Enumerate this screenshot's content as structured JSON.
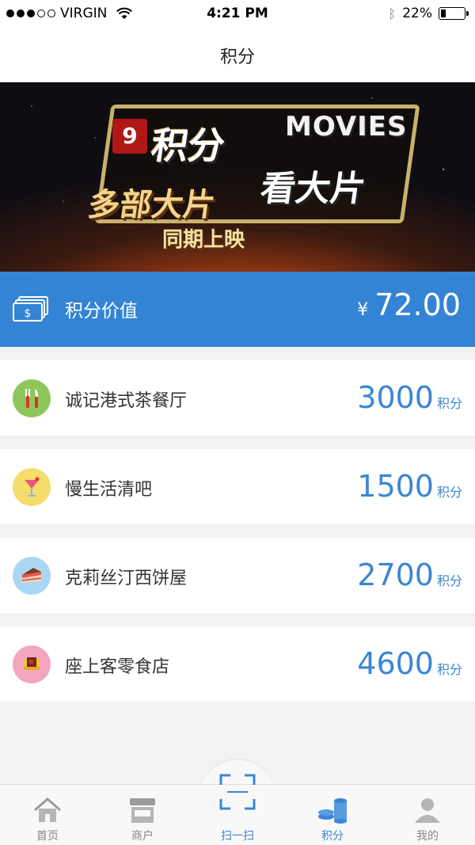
{
  "status_bar": {
    "carrier": "VIRGIN",
    "time": "4:21 PM",
    "battery": "22%",
    "battery_level": 0.22
  },
  "nav": {
    "title": "积分"
  },
  "banner": {
    "badge": "9",
    "line1": "积分",
    "line2": "MOVIES",
    "line3": "看大片",
    "line4": "多部大片",
    "line5": "同期上映"
  },
  "points_value": {
    "icon": "money-icon",
    "label": "积分价值",
    "currency": "¥",
    "amount": "72.00"
  },
  "stores": [
    {
      "name": "诚记港式茶餐厅",
      "points": "3000",
      "unit": "积分",
      "icon": "fork-knife-icon",
      "icon_bg": "#8dc75a"
    },
    {
      "name": "慢生活清吧",
      "points": "1500",
      "unit": "积分",
      "icon": "cocktail-icon",
      "icon_bg": "#f5dd6b"
    },
    {
      "name": "克莉丝汀西饼屋",
      "points": "2700",
      "unit": "积分",
      "icon": "cake-icon",
      "icon_bg": "#a9d7f3"
    },
    {
      "name": "座上客零食店",
      "points": "4600",
      "unit": "积分",
      "icon": "snack-box-icon",
      "icon_bg": "#f3a6c0"
    }
  ],
  "tabs": [
    {
      "label": "首页",
      "icon": "home-icon",
      "active": false
    },
    {
      "label": "商户",
      "icon": "store-icon",
      "active": false
    },
    {
      "label": "扫一扫",
      "icon": "scan-icon",
      "active": false
    },
    {
      "label": "积分",
      "icon": "coins-icon",
      "active": true
    },
    {
      "label": "我的",
      "icon": "user-icon",
      "active": false
    }
  ],
  "colors": {
    "accent": "#3384d5",
    "points_text": "#3b86d3",
    "background": "#f2f2f2"
  }
}
